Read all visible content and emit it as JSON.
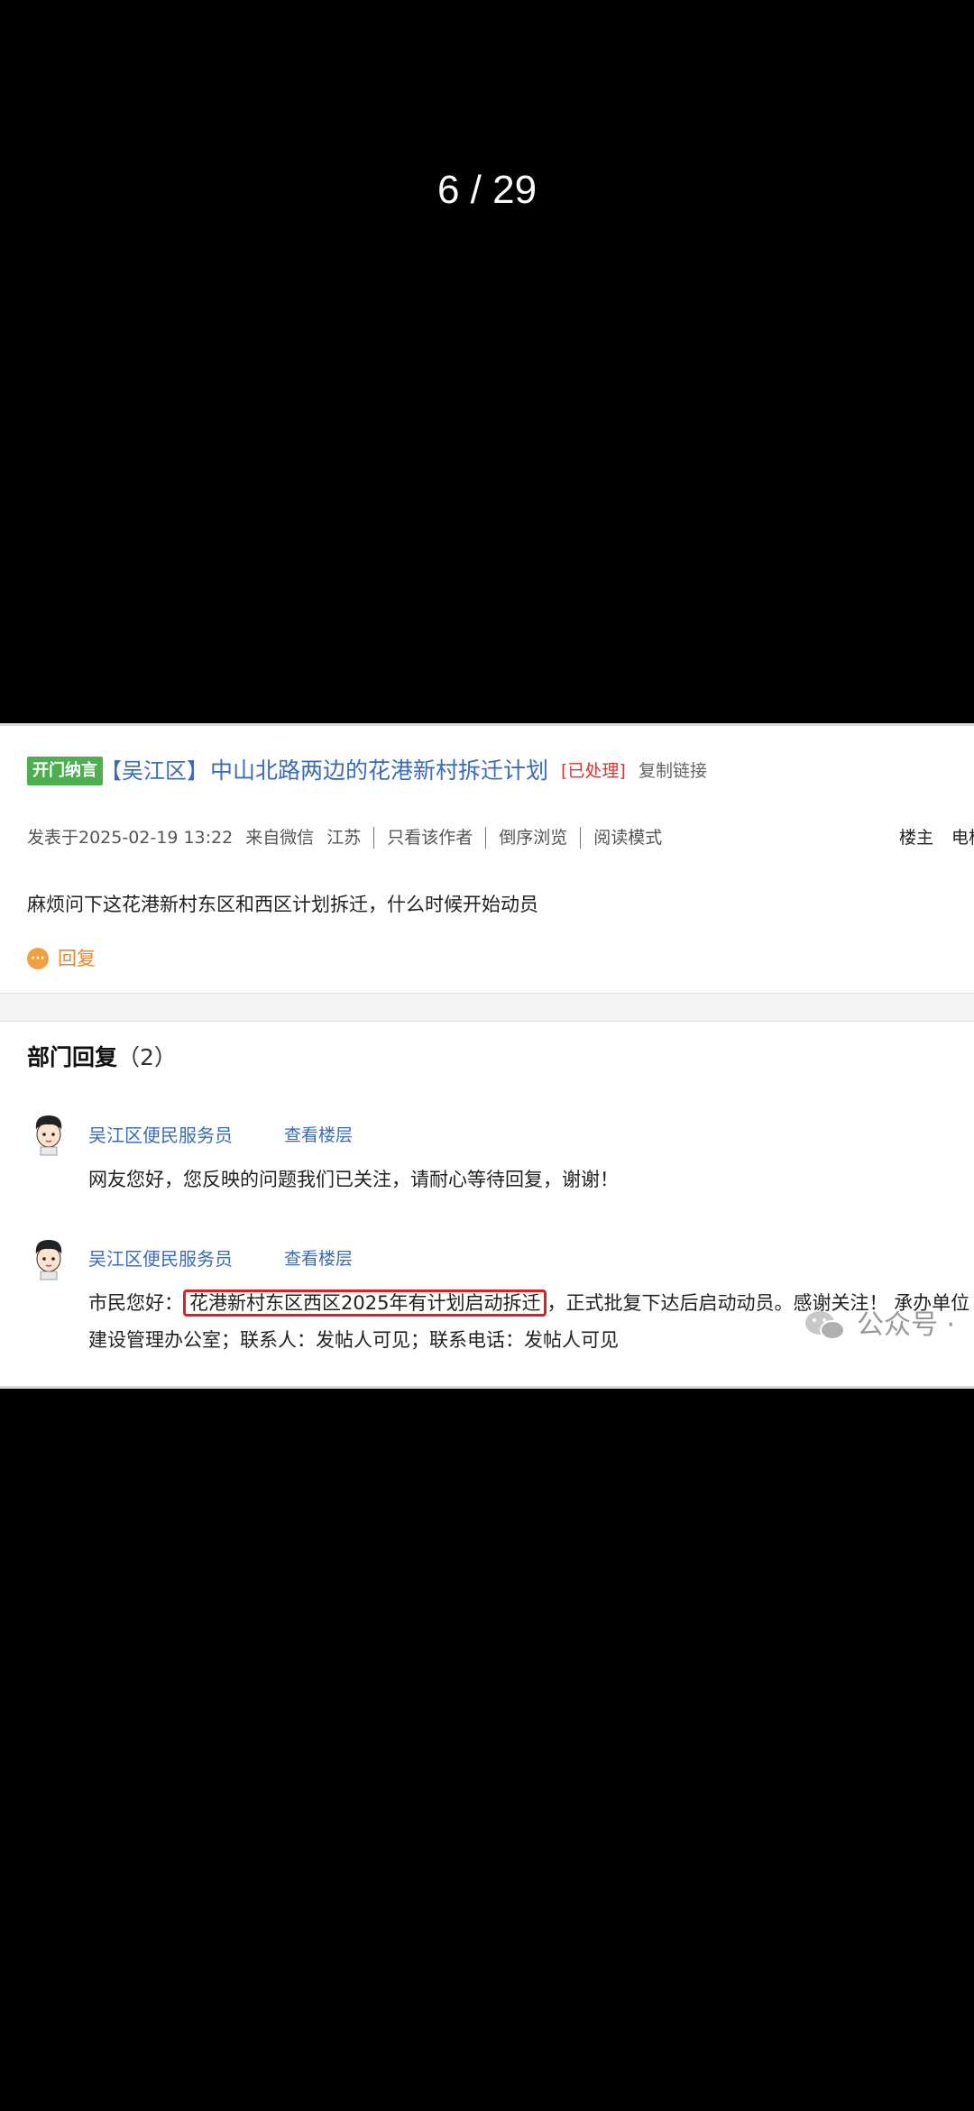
{
  "viewer": {
    "counter": "6 / 29"
  },
  "post": {
    "tag": "开门纳言",
    "district": "【吴江区】",
    "title": "中山北路两边的花港新村拆迁计划",
    "status": "[已处理]",
    "copy_link": "复制链接",
    "meta": {
      "posted": "发表于2025-02-19 13:22",
      "source": "来自微信",
      "region": "江苏",
      "only_author": "只看该作者",
      "reverse": "倒序浏览",
      "read_mode": "阅读模式",
      "owner": "楼主",
      "cut_text": "电梯"
    },
    "question": "麻烦问下这花港新村东区和西区计划拆迁，什么时候开始动员",
    "reply_label": "回复"
  },
  "department": {
    "heading": "部门回复",
    "count": "（2）",
    "replies": [
      {
        "author": "吴江区便民服务员",
        "view_floor": "查看楼层",
        "text": "网友您好，您反映的问题我们已关注，请耐心等待回复，谢谢！"
      },
      {
        "author": "吴江区便民服务员",
        "view_floor": "查看楼层",
        "prefix": "市民您好：",
        "highlight": "花港新村东区西区2025年有计划启动拆迁",
        "suffix": "，正式批复下达后启动动员。感谢关注！ 承办单位",
        "line2": "建设管理办公室；联系人：发帖人可见；联系电话：发帖人可见"
      }
    ]
  },
  "watermark": "公众号 ·"
}
